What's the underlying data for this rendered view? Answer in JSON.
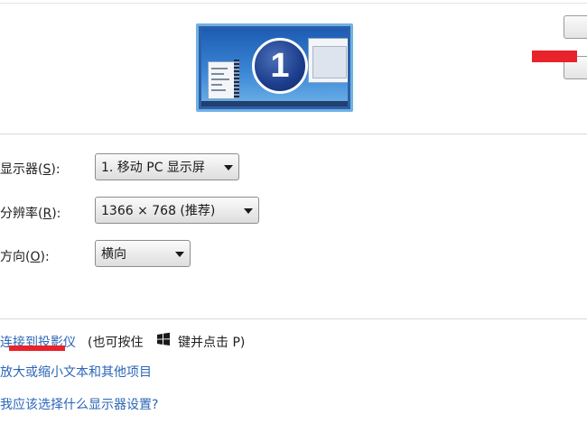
{
  "preview": {
    "monitor_number": "1"
  },
  "form": {
    "display": {
      "label_text": "显示器(",
      "label_key": "S",
      "label_tail": "):",
      "value": "1. 移动 PC 显示屏"
    },
    "resolution": {
      "label_text": "分辨率(",
      "label_key": "R",
      "label_tail": "):",
      "value": "1366 × 768 (推荐)"
    },
    "orientation": {
      "label_text": "方向(",
      "label_key": "O",
      "label_tail": "):",
      "value": "横向"
    }
  },
  "links": {
    "projector": "连接到投影仪",
    "projector_note_a": "(也可按住",
    "projector_note_b": "键并点击 P)",
    "text_size": "放大或缩小文本和其他项目",
    "help": "我应该选择什么显示器设置?"
  },
  "icons": {
    "windows_logo": "windows-logo-icon",
    "dropdown": "chevron-down-icon"
  },
  "colors": {
    "link": "#2a66b8",
    "annotation_red": "#e8232b",
    "monitor_border": "#6fb1e5"
  }
}
